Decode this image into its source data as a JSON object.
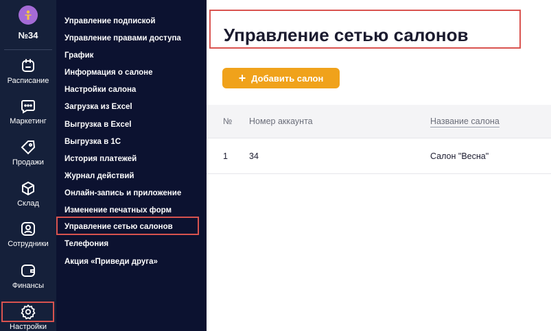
{
  "account": {
    "number": "№34"
  },
  "rail": {
    "items": [
      {
        "label": "Расписание",
        "icon": "calendar-icon"
      },
      {
        "label": "Маркетинг",
        "icon": "chat-icon"
      },
      {
        "label": "Продажи",
        "icon": "tag-icon"
      },
      {
        "label": "Склад",
        "icon": "box-icon"
      },
      {
        "label": "Сотрудники",
        "icon": "person-icon"
      },
      {
        "label": "Финансы",
        "icon": "wallet-icon"
      },
      {
        "label": "Настройки",
        "icon": "gear-icon"
      }
    ]
  },
  "submenu": {
    "items": [
      "Управление подпиской",
      "Управление правами доступа",
      "График",
      "Информация о салоне",
      "Настройки салона",
      "Загрузка из Excel",
      "Выгрузка в Excel",
      "Выгрузка в 1С",
      "История платежей",
      "Журнал действий",
      "Онлайн-запись и приложение",
      "Изменение печатных форм",
      "Управление сетью салонов",
      "Телефония",
      "Акция «Приведи друга»"
    ],
    "active": "Управление сетью салонов"
  },
  "main": {
    "title": "Управление сетью салонов",
    "add_button": {
      "plus": "+",
      "label": "Добавить салон"
    },
    "table": {
      "headers": {
        "num": "№",
        "account": "Номер аккаунта",
        "name": "Название салона"
      },
      "rows": [
        {
          "num": "1",
          "account": "34",
          "name": "Салон \"Весна\""
        }
      ]
    }
  },
  "colors": {
    "rail_bg": "#15203a",
    "submenu_bg": "#0c1230",
    "accent": "#f0a21b",
    "highlight": "#d9534f"
  }
}
